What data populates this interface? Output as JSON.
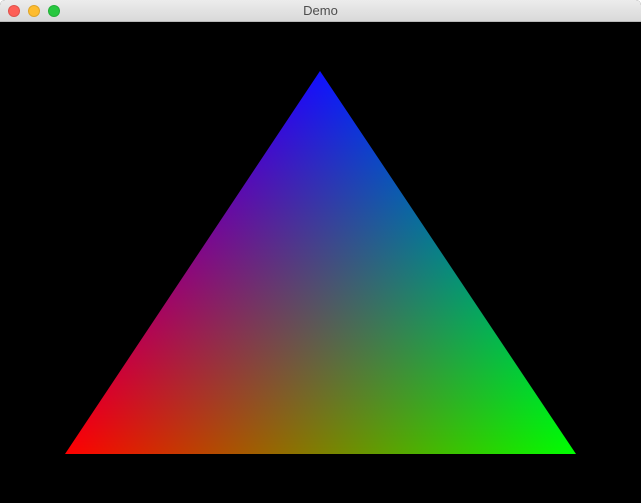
{
  "window": {
    "title": "Demo"
  },
  "traffic_lights": {
    "close_color": "#fe5f57",
    "minimize_color": "#febc2e",
    "zoom_color": "#28c840"
  },
  "canvas": {
    "background": "#000000",
    "vertex_colors": {
      "top": "#0000ff",
      "bottom_left": "#ff0000",
      "bottom_right": "#00ff00"
    }
  }
}
